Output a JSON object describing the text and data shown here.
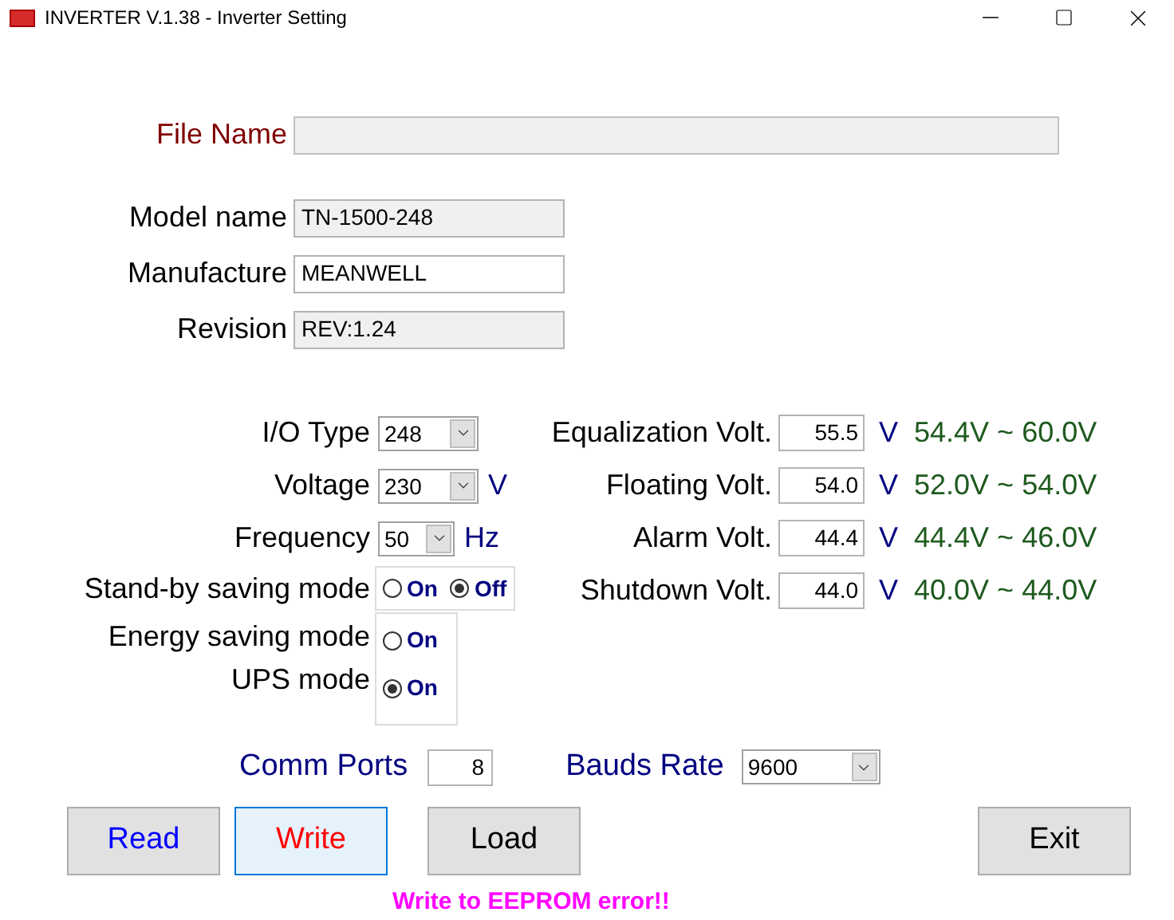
{
  "window": {
    "title": "INVERTER V.1.38 - Inverter Setting"
  },
  "file_name": {
    "label": "File Name"
  },
  "device_info": [
    {
      "label": "Model name",
      "value": "TN-1500-248",
      "disabled": true
    },
    {
      "label": "Manufacture",
      "value": "MEANWELL",
      "disabled": false
    },
    {
      "label": "Revision",
      "value": "REV:1.24",
      "disabled": true
    }
  ],
  "settings": [
    {
      "label": "I/O Type",
      "value": "248"
    },
    {
      "label": "Voltage",
      "value": "230",
      "unit": "V"
    },
    {
      "label": "Frequency",
      "value": "50",
      "unit": "Hz"
    }
  ],
  "modes": [
    {
      "label": "Stand-by saving mode",
      "options": [
        {
          "label": "On",
          "selected": false
        },
        {
          "label": "Off",
          "selected": true
        }
      ]
    },
    {
      "label": "Energy saving mode",
      "options": [
        {
          "label": "On",
          "selected": false
        }
      ]
    },
    {
      "label": "UPS mode",
      "options": [
        {
          "label": "On",
          "selected": true
        }
      ]
    }
  ],
  "voltages": [
    {
      "label": "Equalization Volt.",
      "value": "55.5",
      "unit": "V",
      "range": "54.4V ~ 60.0V"
    },
    {
      "label": "Floating Volt.",
      "value": "54.0",
      "unit": "V",
      "range": "52.0V ~ 54.0V"
    },
    {
      "label": "Alarm Volt.",
      "value": "44.4",
      "unit": "V",
      "range": "44.4V ~ 46.0V"
    },
    {
      "label": "Shutdown Volt.",
      "value": "44.0",
      "unit": "V",
      "range": "40.0V ~ 44.0V"
    }
  ],
  "comm": {
    "ports_label": "Comm Ports",
    "ports_value": "8",
    "baud_label": "Bauds Rate",
    "baud_value": "9600"
  },
  "buttons": [
    {
      "label": "Read",
      "color": "#0000ff",
      "focused": false
    },
    {
      "label": "Write",
      "color": "#ff0000",
      "focused": true
    },
    {
      "label": "Load",
      "color": "#000000",
      "focused": false
    },
    {
      "label": "Exit",
      "color": "#000000",
      "focused": false
    }
  ],
  "status": "Write to EEPROM error!!"
}
